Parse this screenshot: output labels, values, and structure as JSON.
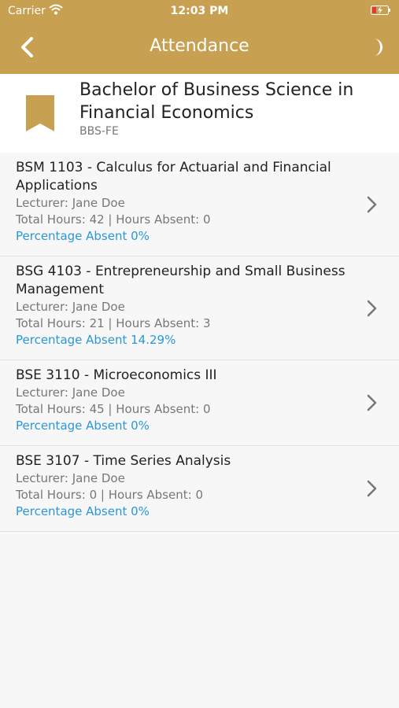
{
  "status_bar": {
    "carrier": "Carrier",
    "time": "12:03 PM",
    "wifi_icon": "wifi-icon",
    "battery_icon": "battery-charging-icon"
  },
  "navbar": {
    "title": "Attendance",
    "back_icon": "chevron-left-icon",
    "theme_icon": "moon-icon",
    "color": "#c7a052"
  },
  "program": {
    "name": "Bachelor of Business Science in Financial Economics",
    "code": "BBS-FE",
    "icon": "bookmark-icon"
  },
  "courses": [
    {
      "title": "BSM 1103 - Calculus for Actuarial and Financial Applications",
      "lecturer": "Lecturer: Jane Doe",
      "hours": "Total Hours: 42 | Hours Absent: 0",
      "percentage": "Percentage Absent 0%"
    },
    {
      "title": "BSG 4103 - Entrepreneurship and Small Business Management",
      "lecturer": "Lecturer: Jane Doe",
      "hours": "Total Hours: 21 | Hours Absent: 3",
      "percentage": "Percentage Absent 14.29%"
    },
    {
      "title": "BSE 3110 - Microeconomics III",
      "lecturer": "Lecturer: Jane Doe",
      "hours": "Total Hours: 45 | Hours Absent: 0",
      "percentage": "Percentage Absent 0%"
    },
    {
      "title": "BSE 3107 - Time Series Analysis",
      "lecturer": "Lecturer: Jane Doe",
      "hours": "Total Hours: 0 | Hours Absent: 0",
      "percentage": "Percentage Absent 0%"
    }
  ],
  "colors": {
    "accent": "#c7a052",
    "link": "#2a97d8"
  }
}
